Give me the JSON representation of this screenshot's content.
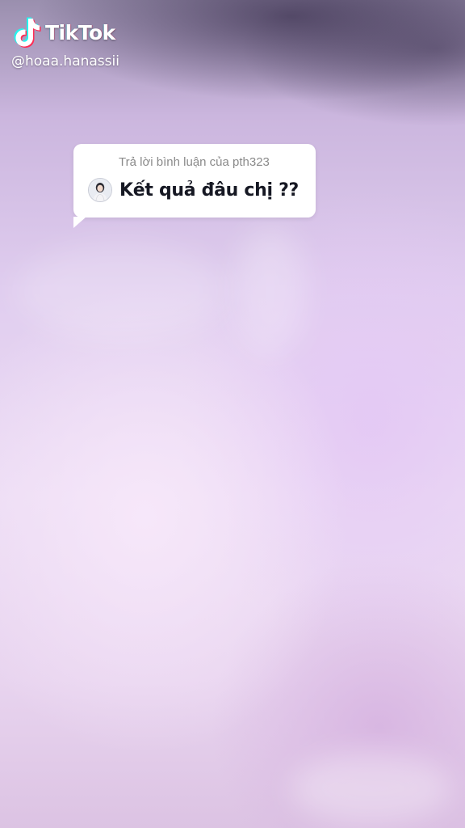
{
  "watermark": {
    "brand": "TikTok",
    "username": "@hoaa.hanassii",
    "logo_icon": "tiktok-logo-icon"
  },
  "reply_comment": {
    "header": "Trả lời bình luận của pth323",
    "text": "Kết quả đâu chị ??",
    "avatar_icon": "avatar"
  },
  "colors": {
    "bubble_bg": "#ffffff",
    "reply_text": "#161823",
    "header_text": "#8a8a8a",
    "tiktok_cyan": "#25f4ee",
    "tiktok_red": "#fe2c55"
  }
}
